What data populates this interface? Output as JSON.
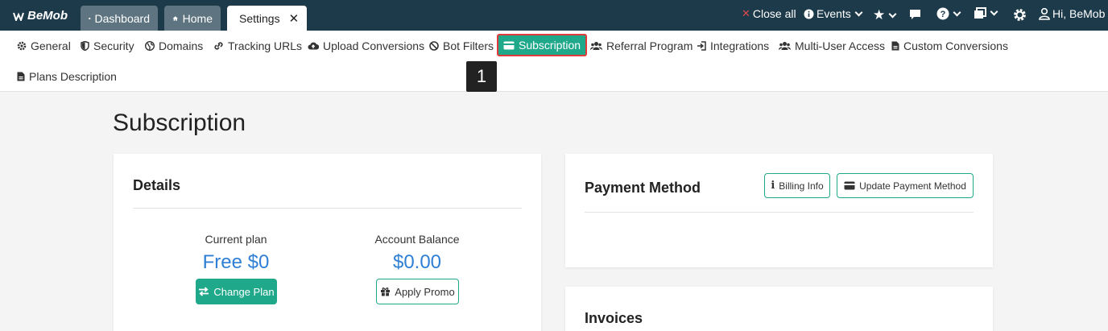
{
  "app": {
    "logo": "BeMob"
  },
  "tabs": [
    {
      "label": "Dashboard"
    },
    {
      "label": "Home"
    },
    {
      "label": "Settings"
    }
  ],
  "top_right": {
    "close_all": "Close all",
    "events": "Events",
    "user": "Hi, BeMob"
  },
  "settings_nav": [
    {
      "label": "General"
    },
    {
      "label": "Security"
    },
    {
      "label": "Domains"
    },
    {
      "label": "Tracking URLs"
    },
    {
      "label": "Upload Conversions"
    },
    {
      "label": "Bot Filters"
    },
    {
      "label": "Subscription"
    },
    {
      "label": "Referral Program"
    },
    {
      "label": "Integrations"
    },
    {
      "label": "Multi-User Access"
    },
    {
      "label": "Custom Conversions"
    },
    {
      "label": "Plans Description"
    }
  ],
  "step_badge": "1",
  "page": {
    "title": "Subscription",
    "details": {
      "title": "Details",
      "current_plan_label": "Current plan",
      "current_plan_value": "Free $0",
      "change_plan": "Change Plan",
      "balance_label": "Account Balance",
      "balance_value": "$0.00",
      "apply_promo": "Apply Promo"
    },
    "payment": {
      "title": "Payment Method",
      "billing_info": "Billing Info",
      "update_payment": "Update Payment Method"
    },
    "invoices": {
      "title": "Invoices"
    }
  },
  "colors": {
    "topbar": "#1c3a4a",
    "accent": "#20a88a",
    "value_blue": "#2f80d4",
    "highlight_border": "#e03a3a"
  }
}
